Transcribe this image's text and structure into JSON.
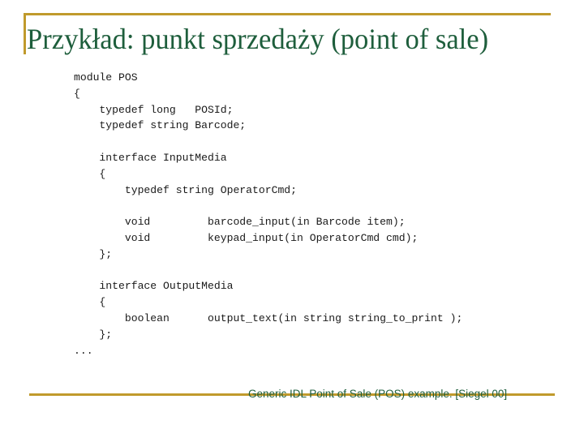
{
  "slide": {
    "title": "Przykład: punkt sprzedaży (point of sale)",
    "accent_color": "#c09a2c",
    "title_color": "#1e5e3c",
    "code_lines": [
      "module POS",
      "{",
      "    typedef long   POSId;",
      "    typedef string Barcode;",
      "",
      "    interface InputMedia",
      "    {",
      "        typedef string OperatorCmd;",
      "",
      "        void         barcode_input(in Barcode item);",
      "        void         keypad_input(in OperatorCmd cmd);",
      "    };",
      "",
      "    interface OutputMedia",
      "    {",
      "        boolean      output_text(in string string_to_print );",
      "    };",
      "..."
    ],
    "caption": "Generic IDL Point of Sale (POS) example. [Siegel 00]"
  }
}
